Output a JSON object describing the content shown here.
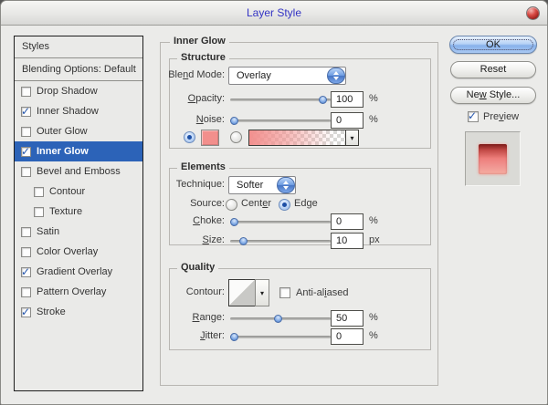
{
  "window": {
    "title": "Layer Style"
  },
  "colors": {
    "selection_blue": "#2c63b8",
    "accent_aqua": "#4675c4",
    "glow_color_swatch": "#f28f8c",
    "dialog_background": "#ebebe9",
    "title_text": "#3434c4"
  },
  "sidebar": {
    "header": "Styles",
    "blending_options": "Blending Options: Default",
    "items": [
      {
        "label": "Drop Shadow",
        "checked": false,
        "selected": false
      },
      {
        "label": "Inner Shadow",
        "checked": true,
        "selected": false
      },
      {
        "label": "Outer Glow",
        "checked": false,
        "selected": false
      },
      {
        "label": "Inner Glow",
        "checked": true,
        "selected": true
      },
      {
        "label": "Bevel and Emboss",
        "checked": false,
        "selected": false
      },
      {
        "label": "Contour",
        "checked": false,
        "selected": false
      },
      {
        "label": "Texture",
        "checked": false,
        "selected": false
      },
      {
        "label": "Satin",
        "checked": false,
        "selected": false
      },
      {
        "label": "Color Overlay",
        "checked": false,
        "selected": false
      },
      {
        "label": "Gradient Overlay",
        "checked": true,
        "selected": false
      },
      {
        "label": "Pattern Overlay",
        "checked": false,
        "selected": false
      },
      {
        "label": "Stroke",
        "checked": true,
        "selected": false
      }
    ]
  },
  "panel": {
    "title": "Inner Glow",
    "structure": {
      "legend": "Structure",
      "blend_mode": {
        "pre": "Ble",
        "key": "n",
        "post": "d Mode:",
        "value": "Overlay"
      },
      "opacity": {
        "key": "O",
        "post": "pacity:",
        "value": "100",
        "unit": "%"
      },
      "noise": {
        "key": "N",
        "post": "oise:",
        "value": "0",
        "unit": "%"
      },
      "solid_color_selected": true,
      "gradient_selected": false,
      "gradient_arrow": "▾"
    },
    "elements": {
      "legend": "Elements",
      "technique": {
        "label": "Technique:",
        "value": "Softer"
      },
      "source": {
        "label": "Source:",
        "center": {
          "pre": "Cent",
          "key": "e",
          "post": "r",
          "selected": false
        },
        "edge": {
          "pre": "Ed",
          "key": "g",
          "post": "e",
          "selected": true
        }
      },
      "choke": {
        "key": "C",
        "post": "hoke:",
        "value": "0",
        "unit": "%"
      },
      "size": {
        "key": "S",
        "post": "ize:",
        "value": "10",
        "unit": "px"
      }
    },
    "quality": {
      "legend": "Quality",
      "contour_label": "Contour:",
      "contour_arrow": "▾",
      "anti_aliased": {
        "pre": "Anti-al",
        "key": "i",
        "post": "ased",
        "checked": false
      },
      "range": {
        "key": "R",
        "post": "ange:",
        "value": "50",
        "unit": "%"
      },
      "jitter": {
        "key": "J",
        "post": "itter:",
        "value": "0",
        "unit": "%"
      }
    }
  },
  "actions": {
    "ok": "OK",
    "reset": "Reset",
    "new_style": {
      "pre": "Ne",
      "key": "w",
      "post": " Style..."
    },
    "preview": {
      "pre": "Pre",
      "key": "v",
      "post": "iew",
      "checked": true
    }
  }
}
